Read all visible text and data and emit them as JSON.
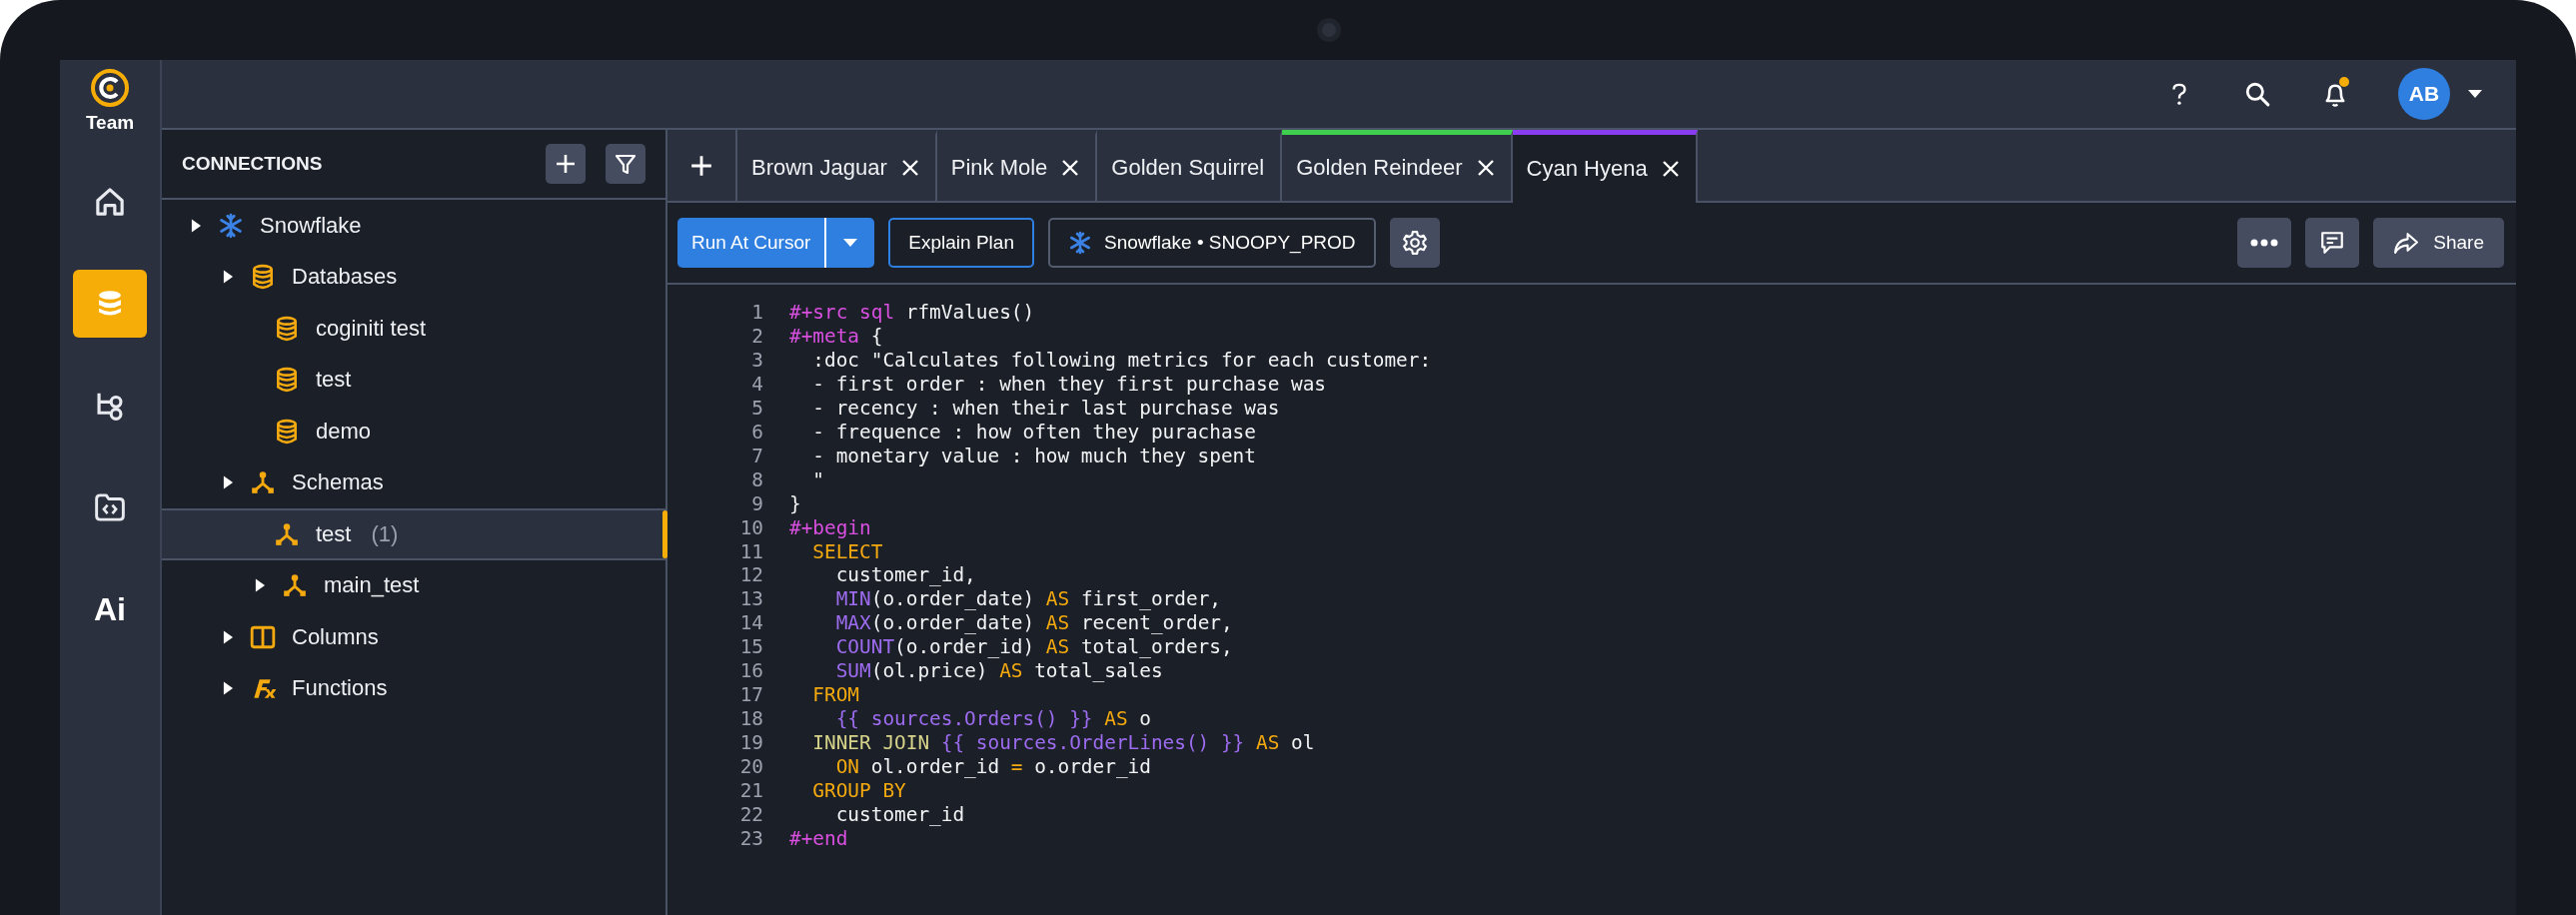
{
  "rail": {
    "logo_label": "Team",
    "items": [
      {
        "kind": "home",
        "selected": false
      },
      {
        "kind": "database",
        "selected": true
      },
      {
        "kind": "flow",
        "selected": false
      },
      {
        "kind": "folder",
        "selected": false
      },
      {
        "kind": "text",
        "label": "Ai",
        "selected": false
      }
    ]
  },
  "topbar": {
    "avatar_initials": "AB",
    "has_notification": true
  },
  "sidebar": {
    "title": "CONNECTIONS",
    "items": [
      {
        "label": "Snowflake",
        "kind": "snowflake",
        "expandable": true,
        "selected": false,
        "children": [
          {
            "label": "Databases",
            "kind": "database",
            "expandable": true,
            "selected": false,
            "children": [
              {
                "label": "coginiti test",
                "kind": "database",
                "expandable": false,
                "selected": false
              },
              {
                "label": "test",
                "kind": "database",
                "expandable": false,
                "selected": false
              },
              {
                "label": "demo",
                "kind": "database",
                "expandable": false,
                "selected": false
              }
            ]
          },
          {
            "label": "Schemas",
            "kind": "schema",
            "expandable": true,
            "selected": false,
            "children": [
              {
                "label": "test",
                "count": "(1)",
                "kind": "schema",
                "expandable": false,
                "selected": true
              },
              {
                "label": "main_test",
                "kind": "schema",
                "expandable": true,
                "selected": false
              }
            ]
          },
          {
            "label": "Columns",
            "kind": "columns",
            "expandable": true,
            "selected": false
          },
          {
            "label": "Functions",
            "kind": "functions",
            "expandable": true,
            "selected": false
          }
        ]
      }
    ]
  },
  "tabs": [
    {
      "label": "Brown Jaguar",
      "closable": true,
      "selected": false
    },
    {
      "label": "Pink Mole",
      "closable": true,
      "selected": false
    },
    {
      "label": "Golden Squirrel",
      "closable": false,
      "selected": false
    },
    {
      "label": "Golden Reindeer",
      "closable": true,
      "selected": false,
      "color": "#3ecf4f"
    },
    {
      "label": "Cyan Hyena",
      "closable": true,
      "selected": true,
      "color": "#8a3cf0"
    }
  ],
  "toolbar": {
    "run_label": "Run At Cursor",
    "explain_label": "Explain Plan",
    "connection": "Snowflake • SNOOPY_PROD",
    "share_label": "Share"
  },
  "editor": {
    "lines": [
      {
        "number": "1",
        "tokens": [
          {
            "kind": "directive",
            "text": "#+src sql"
          },
          {
            "kind": "plain",
            "text": " rfmValues()"
          }
        ]
      },
      {
        "number": "2",
        "tokens": [
          {
            "kind": "directive",
            "text": "#+meta"
          },
          {
            "kind": "plain",
            "text": " {"
          }
        ]
      },
      {
        "number": "3",
        "tokens": [
          {
            "kind": "plain",
            "text": "  :doc \"Calculates following metrics for each customer:"
          }
        ]
      },
      {
        "number": "4",
        "tokens": [
          {
            "kind": "plain",
            "text": "  - first order : when they first purchase was"
          }
        ]
      },
      {
        "number": "5",
        "tokens": [
          {
            "kind": "plain",
            "text": "  - recency : when their last purchase was"
          }
        ]
      },
      {
        "number": "6",
        "tokens": [
          {
            "kind": "plain",
            "text": "  - frequence : how often they purachase"
          }
        ]
      },
      {
        "number": "7",
        "tokens": [
          {
            "kind": "plain",
            "text": "  - monetary value : how much they spent"
          }
        ]
      },
      {
        "number": "8",
        "tokens": [
          {
            "kind": "plain",
            "text": "  \""
          }
        ]
      },
      {
        "number": "9",
        "tokens": [
          {
            "kind": "plain",
            "text": "}"
          }
        ]
      },
      {
        "number": "10",
        "tokens": [
          {
            "kind": "directive",
            "text": "#+begin"
          }
        ]
      },
      {
        "number": "11",
        "tokens": [
          {
            "kind": "keyword",
            "text": "  SELECT"
          }
        ]
      },
      {
        "number": "12",
        "tokens": [
          {
            "kind": "plain",
            "text": "    customer_id,"
          }
        ]
      },
      {
        "number": "13",
        "tokens": [
          {
            "kind": "function",
            "text": "    MIN"
          },
          {
            "kind": "plain",
            "text": "(o.order_date) "
          },
          {
            "kind": "keyword",
            "text": "AS"
          },
          {
            "kind": "plain",
            "text": " first_order,"
          }
        ]
      },
      {
        "number": "14",
        "tokens": [
          {
            "kind": "function",
            "text": "    MAX"
          },
          {
            "kind": "plain",
            "text": "(o.order_date) "
          },
          {
            "kind": "keyword",
            "text": "AS"
          },
          {
            "kind": "plain",
            "text": " recent_order,"
          }
        ]
      },
      {
        "number": "15",
        "tokens": [
          {
            "kind": "function",
            "text": "    COUNT"
          },
          {
            "kind": "plain",
            "text": "(o.order_id) "
          },
          {
            "kind": "keyword",
            "text": "AS"
          },
          {
            "kind": "plain",
            "text": " total_orders,"
          }
        ]
      },
      {
        "number": "16",
        "tokens": [
          {
            "kind": "function",
            "text": "    SUM"
          },
          {
            "kind": "plain",
            "text": "(ol.price) "
          },
          {
            "kind": "keyword",
            "text": "AS"
          },
          {
            "kind": "plain",
            "text": " total_sales"
          }
        ]
      },
      {
        "number": "17",
        "tokens": [
          {
            "kind": "keyword",
            "text": "  FROM"
          }
        ]
      },
      {
        "number": "18",
        "tokens": [
          {
            "kind": "function",
            "text": "    {{ sources.Orders() }}"
          },
          {
            "kind": "keyword",
            "text": " AS"
          },
          {
            "kind": "plain",
            "text": " o"
          }
        ]
      },
      {
        "number": "19",
        "tokens": [
          {
            "kind": "join",
            "text": "  INNER JOIN"
          },
          {
            "kind": "function",
            "text": " {{ sources.OrderLines() }}"
          },
          {
            "kind": "keyword",
            "text": " AS"
          },
          {
            "kind": "plain",
            "text": " ol"
          }
        ]
      },
      {
        "number": "20",
        "tokens": [
          {
            "kind": "keyword",
            "text": "    ON"
          },
          {
            "kind": "plain",
            "text": " ol.order_id "
          },
          {
            "kind": "keyword",
            "text": "="
          },
          {
            "kind": "plain",
            "text": " o.order_id"
          }
        ]
      },
      {
        "number": "21",
        "tokens": [
          {
            "kind": "keyword",
            "text": "  GROUP BY"
          }
        ]
      },
      {
        "number": "22",
        "tokens": [
          {
            "kind": "plain",
            "text": "    customer_id"
          }
        ]
      },
      {
        "number": "23",
        "tokens": [
          {
            "kind": "directive",
            "text": "#+end"
          }
        ]
      }
    ]
  }
}
